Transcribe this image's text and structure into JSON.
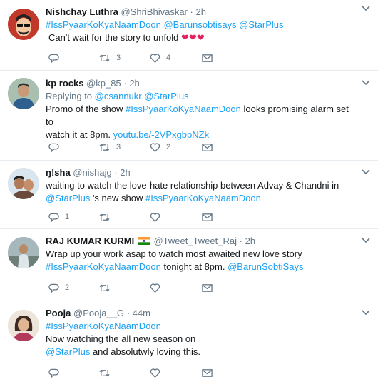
{
  "tweets": [
    {
      "name": "Nishchay Luthra",
      "handle": "@ShriBhivaskar",
      "time": "2h",
      "line1": "#IssPyaarKoKyaNaamDoon @Barunsobtisays @StarPlus",
      "line2": "Can't wait for the story to unfold",
      "emoji": "❤❤❤",
      "reply_count": "",
      "retweet_count": "3",
      "like_count": "4"
    },
    {
      "name": "kp rocks",
      "handle": "@kp_85",
      "time": "2h",
      "replying_label": "Replying to",
      "replying_to": "@csannukr @StarPlus",
      "promo_a": "Promo of the show",
      "hashtag": "#IssPyaarKoKyaNaamDoon",
      "promo_b": "looks promising alarm set to",
      "line2_a": "watch it at 8pm.",
      "link": "youtu.be/-2VPxgbpNZk",
      "reply_count": "",
      "retweet_count": "3",
      "like_count": "2"
    },
    {
      "name": "ŋ!sha",
      "handle": "@nishajg",
      "time": "2h",
      "line1": "waiting to  watch the love-hate relationship between Advay & Chandni in",
      "mention": "@StarPlus",
      "line2_mid": "'s new show",
      "hashtag": "#IssPyaarKoKyaNaamDoon",
      "reply_count": "1",
      "retweet_count": "",
      "like_count": ""
    },
    {
      "name": "RAJ KUMAR KURMI",
      "handle": "@Tweet_Tweet_Raj",
      "time": "2h",
      "line1": "Wrap up your work asap to watch most awaited new love story",
      "hashtag": "#IssPyaarKoKyaNaamDoon",
      "line2_mid": "tonight at 8pm.",
      "mention": "@BarunSobtiSays",
      "reply_count": "2",
      "retweet_count": "",
      "like_count": ""
    },
    {
      "name": "Pooja",
      "handle": "@Pooja__G",
      "time": "44m",
      "line1": "#IssPyaarKoKyaNaamDoon",
      "line2": "Now watching the all new season on",
      "mention": "@StarPlus",
      "line3_rest": "and absolutwly loving this.",
      "reply_count": "",
      "retweet_count": "",
      "like_count": ""
    }
  ],
  "dot": "·",
  "colors": {
    "link": "#1da1f2",
    "muted": "#657786",
    "heart": "#e0245e",
    "divider": "#e6ecf0"
  }
}
